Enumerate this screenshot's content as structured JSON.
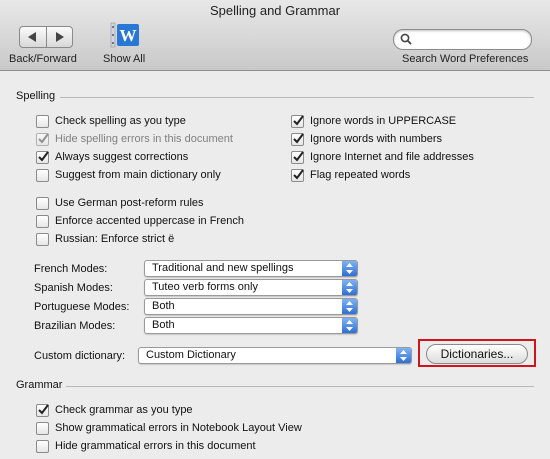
{
  "window": {
    "title": "Spelling and Grammar"
  },
  "toolbar": {
    "back_forward_label": "Back/Forward",
    "show_all_label": "Show All",
    "search_label": "Search Word Preferences",
    "search_value": "",
    "search_placeholder": ""
  },
  "spelling": {
    "title": "Spelling",
    "left_options": [
      {
        "label": "Check spelling as you type",
        "checked": false,
        "disabled": false
      },
      {
        "label": "Hide spelling errors in this document",
        "checked": true,
        "disabled": true
      },
      {
        "label": "Always suggest corrections",
        "checked": true,
        "disabled": false
      },
      {
        "label": "Suggest from main dictionary only",
        "checked": false,
        "disabled": false
      }
    ],
    "right_options": [
      {
        "label": "Ignore words in UPPERCASE",
        "checked": true,
        "disabled": false
      },
      {
        "label": "Ignore words with numbers",
        "checked": true,
        "disabled": false
      },
      {
        "label": "Ignore Internet and file addresses",
        "checked": true,
        "disabled": false
      },
      {
        "label": "Flag repeated words",
        "checked": true,
        "disabled": false
      }
    ],
    "language_options": [
      {
        "label": "Use German post-reform rules",
        "checked": false
      },
      {
        "label": "Enforce accented uppercase in French",
        "checked": false
      },
      {
        "label": "Russian: Enforce strict ë",
        "checked": false
      }
    ],
    "modes": [
      {
        "label": "French Modes:",
        "value": "Traditional and new spellings"
      },
      {
        "label": "Spanish Modes:",
        "value": "Tuteo verb forms only"
      },
      {
        "label": "Portuguese Modes:",
        "value": "Both"
      },
      {
        "label": "Brazilian Modes:",
        "value": "Both"
      }
    ],
    "custom_dictionary_label": "Custom dictionary:",
    "custom_dictionary_value": "Custom Dictionary",
    "dictionaries_button": "Dictionaries..."
  },
  "grammar": {
    "title": "Grammar",
    "options": [
      {
        "label": "Check grammar as you type",
        "checked": true
      },
      {
        "label": "Show grammatical errors in Notebook Layout View",
        "checked": false
      },
      {
        "label": "Hide grammatical errors in this document",
        "checked": false
      }
    ]
  },
  "colors": {
    "highlight_border": "#d1141b",
    "popup_arrow": "#2f6fd6"
  }
}
